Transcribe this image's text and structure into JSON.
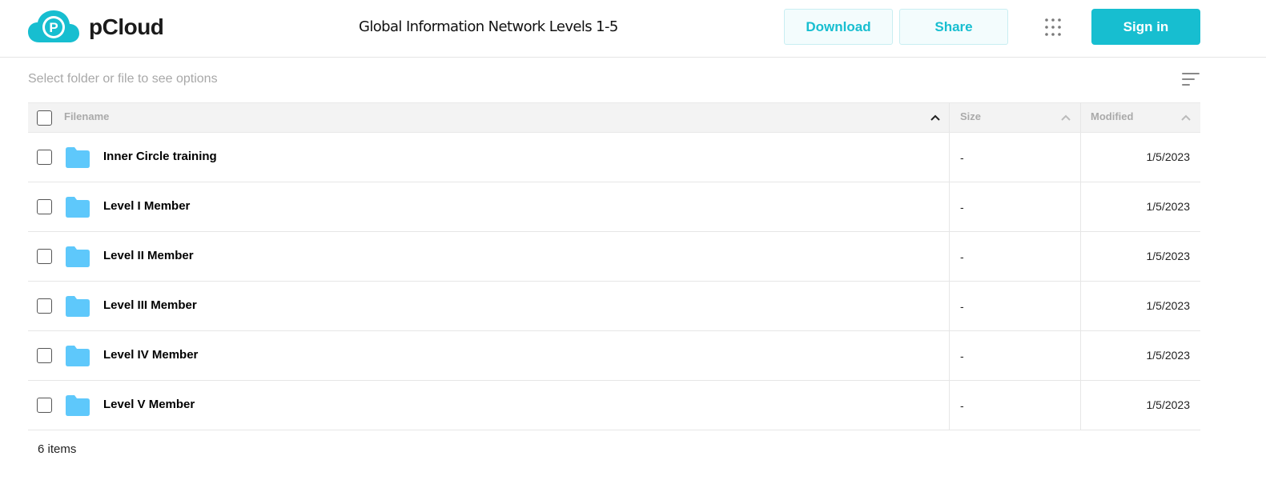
{
  "app": {
    "name": "pCloud",
    "logo_letter": "P",
    "brand_color": "#17bed0"
  },
  "header": {
    "title": "Global Information Network Levels 1-5",
    "download_label": "Download",
    "share_label": "Share",
    "signin_label": "Sign in",
    "apps_icon": "grid-icon"
  },
  "toolbar": {
    "hint": "Select folder or file to see options",
    "sort_icon": "sort-lines-icon"
  },
  "table": {
    "columns": {
      "name": "Filename",
      "size": "Size",
      "modified": "Modified"
    },
    "rows": [
      {
        "name": "Inner Circle training",
        "size": "-",
        "modified": "1/5/2023",
        "icon": "folder-icon"
      },
      {
        "name": "Level I Member",
        "size": "-",
        "modified": "1/5/2023",
        "icon": "folder-icon"
      },
      {
        "name": "Level II Member",
        "size": "-",
        "modified": "1/5/2023",
        "icon": "folder-icon"
      },
      {
        "name": "Level III Member",
        "size": "-",
        "modified": "1/5/2023",
        "icon": "folder-icon"
      },
      {
        "name": "Level IV Member",
        "size": "-",
        "modified": "1/5/2023",
        "icon": "folder-icon"
      },
      {
        "name": "Level V Member",
        "size": "-",
        "modified": "1/5/2023",
        "icon": "folder-icon"
      }
    ]
  },
  "footer": {
    "count": "6 items"
  },
  "colors": {
    "folder": "#5ec8fb",
    "accent": "#17bed0",
    "header_bg": "#f3f3f3"
  }
}
